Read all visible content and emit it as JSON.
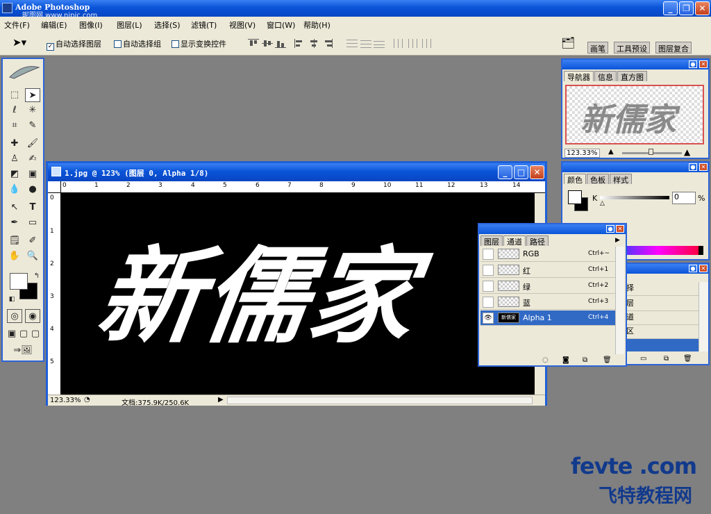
{
  "app": {
    "title": "Adobe Photoshop",
    "watermark_text": "昵图网 www.nipic.com"
  },
  "menu": [
    "文件(F)",
    "编辑(E)",
    "图像(I)",
    "图层(L)",
    "选择(S)",
    "滤镜(T)",
    "视图(V)",
    "窗口(W)",
    "帮助(H)"
  ],
  "options": {
    "auto_select_layer": "自动选择图层",
    "auto_select_group": "自动选择组",
    "show_transform": "显示变换控件",
    "palette_tabs": [
      "画笔",
      "工具预设",
      "图层复合"
    ]
  },
  "document": {
    "title": "1.jpg @ 123% (图层 0, Alpha 1/8)",
    "ruler_h": [
      "0",
      "1",
      "2",
      "3",
      "4",
      "5",
      "6",
      "7",
      "8",
      "9",
      "10",
      "11",
      "12",
      "13",
      "14"
    ],
    "ruler_v": [
      "0",
      "1",
      "2",
      "3",
      "4",
      "5"
    ],
    "artwork_text": "新儒家",
    "zoom": "123.33%",
    "doc_size": "文档:375.9K/250.6K"
  },
  "navigator": {
    "tabs": [
      "导航器",
      "信息",
      "直方图"
    ],
    "zoom": "123.33%",
    "preview_text": "新儒家"
  },
  "color_panel": {
    "tabs": [
      "颜色",
      "色板",
      "样式"
    ],
    "channel_label": "K",
    "value": "0",
    "unit": "%"
  },
  "channels_panel": {
    "tabs": [
      "图层",
      "通道",
      "路径"
    ],
    "rows": [
      {
        "name": "RGB",
        "shortcut": "Ctrl+~",
        "visible": false
      },
      {
        "name": "红",
        "shortcut": "Ctrl+1",
        "visible": false
      },
      {
        "name": "绿",
        "shortcut": "Ctrl+2",
        "visible": false
      },
      {
        "name": "蓝",
        "shortcut": "Ctrl+3",
        "visible": false
      },
      {
        "name": "Alpha 1",
        "shortcut": "Ctrl+4",
        "visible": true,
        "selected": true
      }
    ]
  },
  "back_layers_panel": {
    "items": [
      "择",
      "层",
      "道",
      "区"
    ]
  },
  "brand": {
    "line1": "fevte .com",
    "line2": "飞特教程网"
  }
}
